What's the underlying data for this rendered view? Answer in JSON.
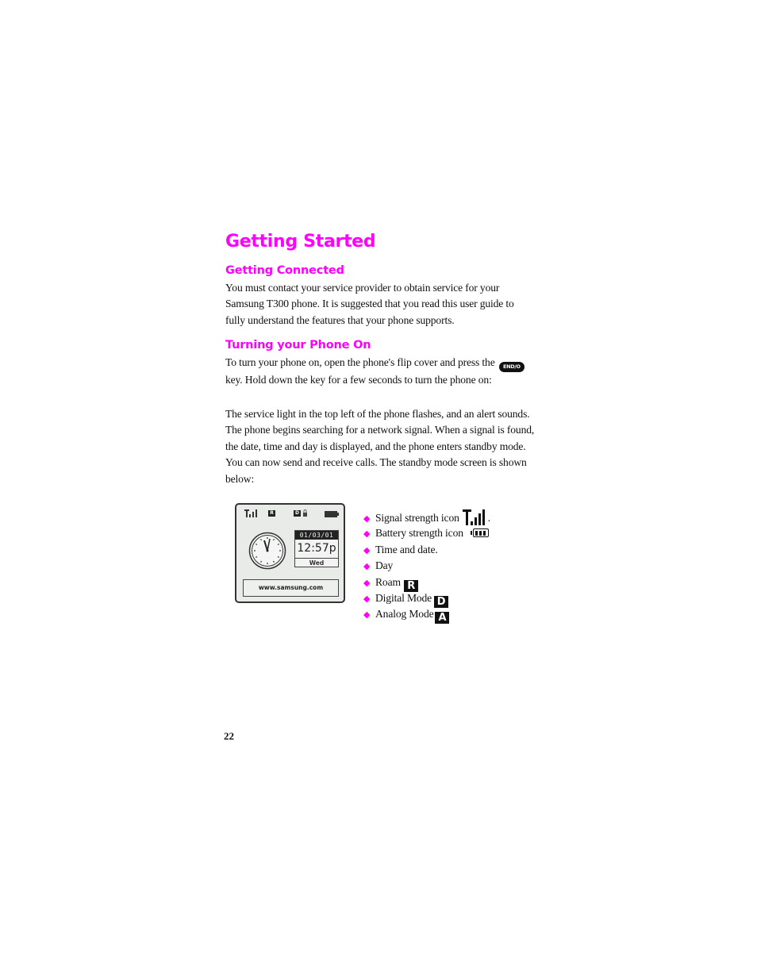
{
  "title": "Getting Started",
  "sections": [
    {
      "heading": "Getting Connected",
      "paragraphs": [
        "You must contact your service provider to obtain service for your Samsung T300 phone. It is suggested that you read this user guide to fully understand the features that your phone supports."
      ]
    },
    {
      "heading": "Turning your Phone On",
      "intro_before_key": "To turn your phone on, open the phone's flip cover and press the",
      "key_label": "END/O",
      "intro_after_key": "key. Hold down the key for a few seconds to turn the phone on:",
      "paragraph2": "The service light in the top left of the phone flashes, and an alert sounds. The phone begins searching for a network signal. When a signal is found, the date, time and day is displayed, and the phone enters standby mode. You can now send and receive calls. The standby mode screen is shown below:"
    }
  ],
  "phone_screen": {
    "roam_badge": "R",
    "digital_badge": "D",
    "date": "01/03/01",
    "time": "12:57p",
    "day": "Wed",
    "url": "www.samsung.com"
  },
  "legend": [
    {
      "label": "Signal strength icon",
      "icon": "signal-strength-icon",
      "suffix": "."
    },
    {
      "label": "Battery strength icon",
      "icon": "battery-icon"
    },
    {
      "label": "Time and date.",
      "icon": null
    },
    {
      "label": "Day",
      "icon": null
    },
    {
      "label": "Roam",
      "icon": "roam-icon",
      "badge": "R"
    },
    {
      "label": "Digital Mode",
      "icon": "digital-mode-icon",
      "badge": "D"
    },
    {
      "label": "Analog Mode",
      "icon": "analog-mode-icon",
      "badge": "A"
    }
  ],
  "bullet_glyph": "◆",
  "accent_color": "#ff00ff",
  "page_number": "22"
}
